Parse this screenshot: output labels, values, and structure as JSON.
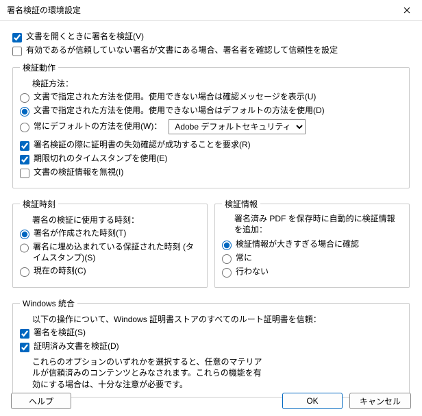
{
  "title": "署名検証の環境設定",
  "top": {
    "verify_on_open": "文書を開くときに署名を検証(V)",
    "trust_unknown": "有効であるが信頼していない署名が文書にある場合、署名者を確認して信頼性を設定"
  },
  "behavior": {
    "legend": "検証動作",
    "method_label": "検証方法：",
    "opt_doc_confirm": "文書で指定された方法を使用。使用できない場合は確認メッセージを表示(U)",
    "opt_doc_default": "文書で指定された方法を使用。使用できない場合はデフォルトの方法を使用(D)",
    "opt_always_default": "常にデフォルトの方法を使用(W)：",
    "default_select": "Adobe デフォルトセキュリティ",
    "revocation": "署名検証の際に証明書の失効確認が成功することを要求(R)",
    "expired_ts": "期限切れのタイムスタンプを使用(E)",
    "ignore_info": "文書の検証情報を無視(I)"
  },
  "time": {
    "legend": "検証時刻",
    "label": "署名の検証に使用する時刻：",
    "opt_created": "署名が作成された時刻(T)",
    "opt_embedded": "署名に埋め込まれている保証された時刻 (タイムスタンプ)(S)",
    "opt_current": "現在の時刻(C)"
  },
  "info": {
    "legend": "検証情報",
    "label": "署名済み PDF を保存時に自動的に検証情報を追加：",
    "opt_confirm": "検証情報が大きすぎる場合に確認",
    "opt_always": "常に",
    "opt_never": "行わない"
  },
  "windows": {
    "legend": "Windows 統合",
    "label": "以下の操作について、Windows 証明書ストアのすべてのルート証明書を信頼：",
    "verify_sig": "署名を検証(S)",
    "verify_doc": "証明済み文書を検証(D)",
    "hint": "これらのオプションのいずれかを選択すると、任意のマテリアルが信頼済みのコンテンツとみなされます。これらの機能を有効にする場合は、十分な注意が必要です。"
  },
  "buttons": {
    "help": "ヘルプ",
    "ok": "OK",
    "cancel": "キャンセル"
  }
}
